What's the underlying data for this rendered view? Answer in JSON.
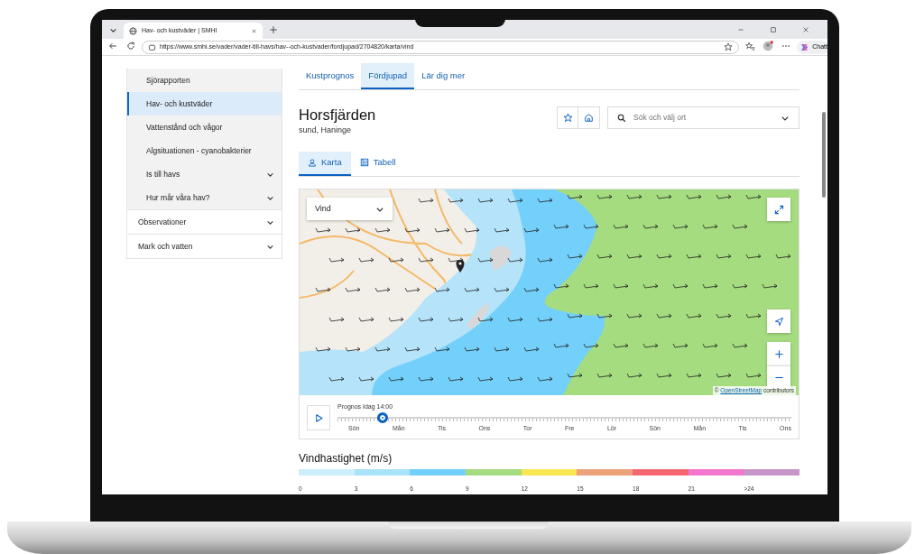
{
  "browser": {
    "tab_title": "Hav- och kustväder | SMHI",
    "url": "https://www.smhi.se/vader/vader-till-havs/hav--och-kustvader/fordjupad/2704820/karta/vind",
    "profile_button": "Chatt"
  },
  "sidebar": {
    "items": [
      {
        "label": "Sjörapporten",
        "kind": "sub",
        "expandable": false,
        "selected": false
      },
      {
        "label": "Hav- och kustväder",
        "kind": "sub",
        "expandable": false,
        "selected": true
      },
      {
        "label": "Vattenstånd och vågor",
        "kind": "sub",
        "expandable": false,
        "selected": false
      },
      {
        "label": "Algsituationen - cyanobakterier",
        "kind": "sub",
        "expandable": false,
        "selected": false
      },
      {
        "label": "Is till havs",
        "kind": "sub",
        "expandable": true,
        "selected": false
      },
      {
        "label": "Hur mår våra hav?",
        "kind": "sub",
        "expandable": true,
        "selected": false
      },
      {
        "label": "Observationer",
        "kind": "section",
        "expandable": true,
        "selected": false
      },
      {
        "label": "Mark och vatten",
        "kind": "section",
        "expandable": true,
        "selected": false
      }
    ]
  },
  "tabs": [
    {
      "label": "Kustprognos",
      "selected": false
    },
    {
      "label": "Fördjupad",
      "selected": true
    },
    {
      "label": "Lär dig mer",
      "selected": false
    }
  ],
  "location": {
    "title": "Horsfjärden",
    "subtitle": "sund, Haninge"
  },
  "search": {
    "placeholder": "Sök och välj ort"
  },
  "view_tabs": [
    {
      "label": "Karta",
      "kind": "map",
      "selected": true
    },
    {
      "label": "Tabell",
      "kind": "table",
      "selected": false
    }
  ],
  "map": {
    "layer": "Vind",
    "attribution": {
      "prefix": "©",
      "link": "OpenStreetMap",
      "suffix": "contributors"
    }
  },
  "timeline": {
    "label": "Prognos Idag 14:00",
    "level": 0.1,
    "days": [
      "Sön",
      "Mån",
      "Tis",
      "Ons",
      "Tor",
      "Fre",
      "Lör",
      "Sön",
      "Mån",
      "Tis",
      "Ons"
    ]
  },
  "legend": {
    "title": "Vindhastighet (m/s)",
    "segments": [
      {
        "label": "0",
        "color": "#cdeefb"
      },
      {
        "label": "3",
        "color": "#a9e2f9"
      },
      {
        "label": "6",
        "color": "#73d0fa"
      },
      {
        "label": "9",
        "color": "#a5dc80"
      },
      {
        "label": "12",
        "color": "#f8e752"
      },
      {
        "label": "15",
        "color": "#eea27a"
      },
      {
        "label": "18",
        "color": "#f66670"
      },
      {
        "label": "21",
        "color": "#f376cf"
      },
      {
        "label": ">24",
        "color": "#c895c9"
      }
    ]
  }
}
